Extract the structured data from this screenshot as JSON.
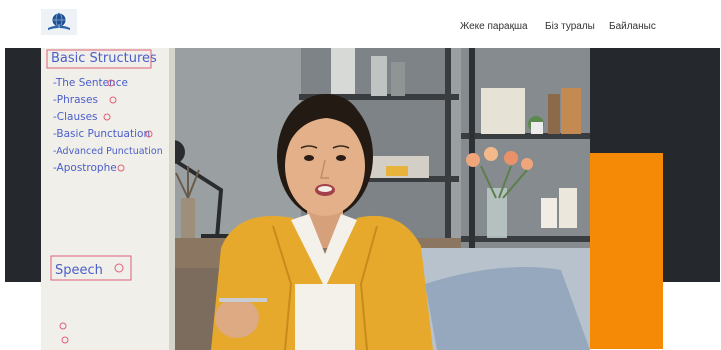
{
  "header": {
    "logo_icon": "globe-book-logo",
    "nav": [
      {
        "label": "Жеке парақша",
        "icon": null
      },
      {
        "label": "Біз туралы",
        "icon": null
      },
      {
        "label": "Байланыс",
        "icon": null
      }
    ]
  },
  "hero": {
    "image_subject": "Woman speaking on video call in front of whiteboard",
    "whiteboard": {
      "heading": "Basic Structures",
      "items": [
        "-The Sentence",
        "-Phrases",
        "-Clauses",
        "-Basic Punctuation",
        "-Advanced Punctuation",
        "-Apostrophe"
      ],
      "section": "Speech"
    }
  },
  "colors": {
    "accent_orange": "#f58a07",
    "dark_band": "#25282c",
    "nav_text": "#333333",
    "board_ink": "#4a5ec8",
    "board_marker": "#e0607a"
  }
}
